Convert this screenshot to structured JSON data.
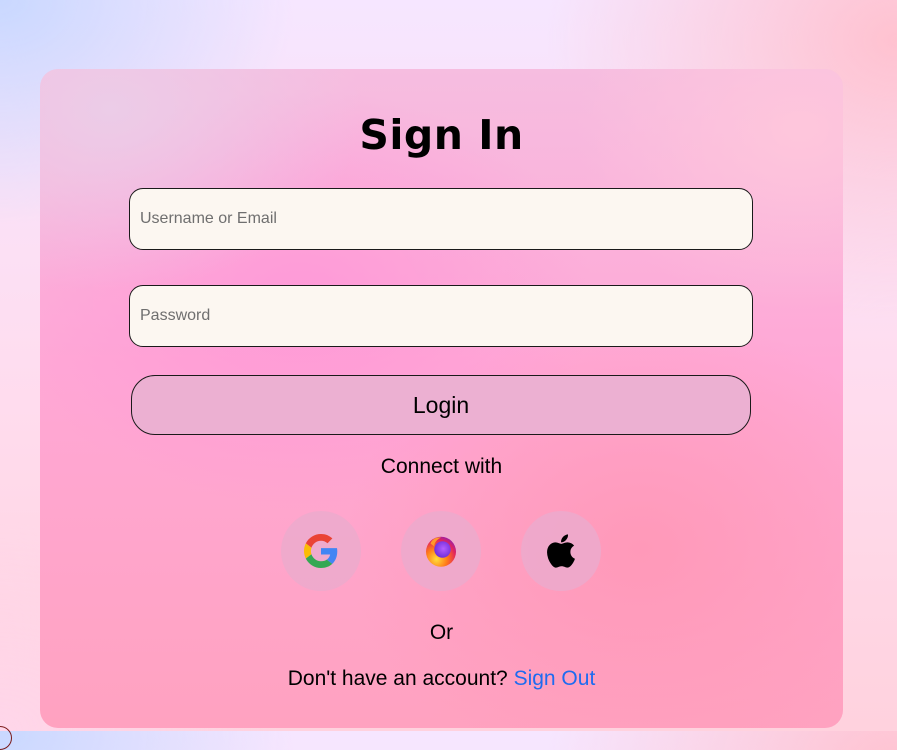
{
  "title": "Sign In",
  "form": {
    "username_placeholder": "Username or Email",
    "username_value": "",
    "password_placeholder": "Password",
    "password_value": "",
    "login_label": "Login"
  },
  "social": {
    "heading": "Connect with",
    "providers": [
      {
        "name": "google",
        "icon": "google-icon"
      },
      {
        "name": "firefox",
        "icon": "firefox-icon"
      },
      {
        "name": "apple",
        "icon": "apple-icon"
      }
    ]
  },
  "divider_text": "Or",
  "footer": {
    "prompt": "Don't have an account?",
    "link_label": "Sign Out"
  },
  "colors": {
    "link": "#1e6bf0",
    "input_bg": "#fcf7f1",
    "button_bg": "#ecb0d2"
  }
}
